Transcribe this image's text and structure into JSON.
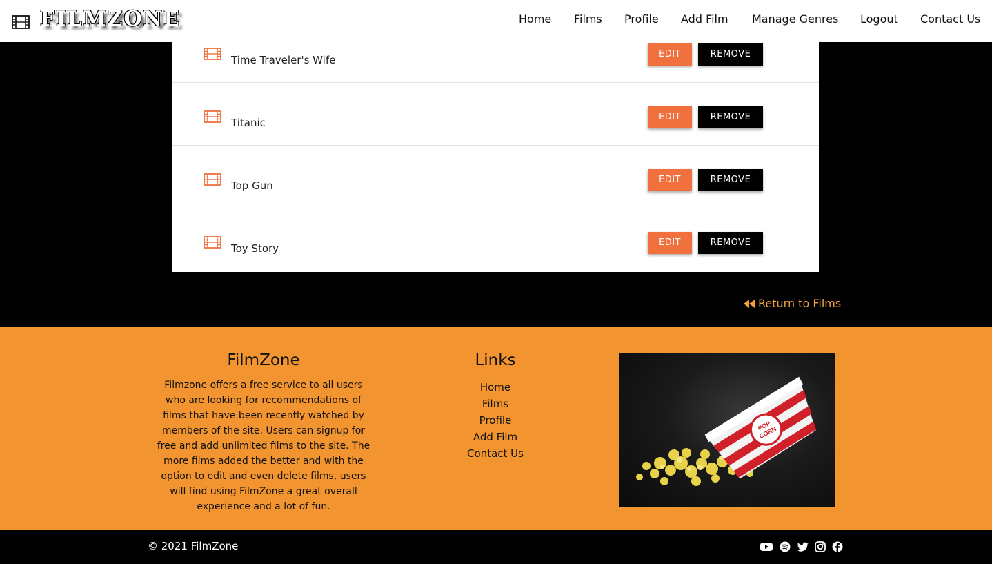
{
  "navbar": {
    "brand": "FILMZONE",
    "brand_icon": "film-icon",
    "links": [
      "Home",
      "Films",
      "Profile",
      "Add Film",
      "Manage Genres",
      "Logout",
      "Contact Us"
    ]
  },
  "films": [
    {
      "title": "Time Traveler's Wife",
      "edit_label": "EDIT",
      "remove_label": "REMOVE"
    },
    {
      "title": "Titanic",
      "edit_label": "EDIT",
      "remove_label": "REMOVE"
    },
    {
      "title": "Top Gun",
      "edit_label": "EDIT",
      "remove_label": "REMOVE"
    },
    {
      "title": "Toy Story",
      "edit_label": "EDIT",
      "remove_label": "REMOVE"
    }
  ],
  "return_link": {
    "label": "Return to Films",
    "icon": "backward-icon"
  },
  "footer": {
    "about_title": "FilmZone",
    "about_text": "Filmzone offers a free service to all users who are looking for recommendations of films that have been recently watched by members of the site. Users can signup for free and add unlimited films to the site. The more films added the better and with the option to edit and even delete films, users will find using FilmZone a great overall experience and a lot of fun.",
    "links_title": "Links",
    "links": [
      "Home",
      "Films",
      "Profile",
      "Add Film",
      "Contact Us"
    ],
    "image": "popcorn-image"
  },
  "bottom": {
    "copyright": "© 2021 FilmZone",
    "social_icons": [
      "youtube-icon",
      "spotify-icon",
      "twitter-icon",
      "instagram-icon",
      "facebook-icon"
    ]
  },
  "colors": {
    "edit_button": "#f0703e",
    "remove_button": "#000000",
    "footer_bg": "#f2942f",
    "return_link": "#f0a03c"
  }
}
